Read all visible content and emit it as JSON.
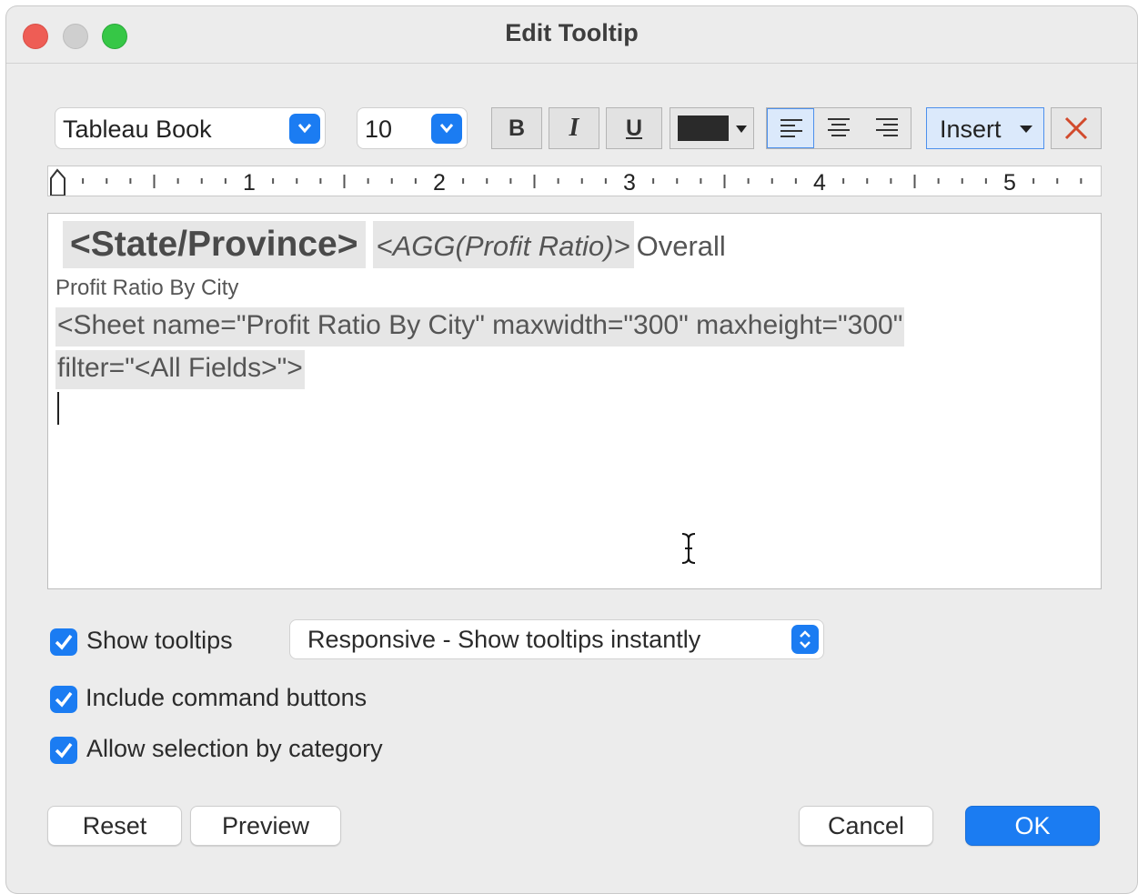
{
  "window": {
    "title": "Edit Tooltip"
  },
  "toolbar": {
    "font_family": "Tableau Book",
    "font_size": "10",
    "bold_label": "B",
    "italic_label": "I",
    "underline_label": "U",
    "text_color": "#2a2a2a",
    "insert_label": "Insert",
    "clear_icon": "close-x-icon",
    "alignment_selected": "left"
  },
  "ruler": {
    "numbers": [
      "1",
      "2",
      "3",
      "4",
      "5"
    ]
  },
  "editor": {
    "field_state": "<State/Province>",
    "field_agg": "<AGG(Profit Ratio)>",
    "text_overall": "Overall",
    "text_profit_ratio": "Profit Ratio By City",
    "sheet_line1": "<Sheet name=\"Profit Ratio By City\" maxwidth=\"300\" maxheight=\"300\"",
    "sheet_line2": "filter=\"<All Fields>\">"
  },
  "options": {
    "show_tooltips": {
      "label": "Show tooltips",
      "checked": true
    },
    "tooltip_mode": "Responsive - Show tooltips instantly",
    "include_command_buttons": {
      "label": "Include command buttons",
      "checked": true
    },
    "allow_selection_by_category": {
      "label": "Allow selection by category",
      "checked": true
    }
  },
  "buttons": {
    "reset": "Reset",
    "preview": "Preview",
    "cancel": "Cancel",
    "ok": "OK"
  },
  "colors": {
    "accent": "#1b7cf2",
    "close": "#ee5d55",
    "maximize": "#36c746"
  }
}
